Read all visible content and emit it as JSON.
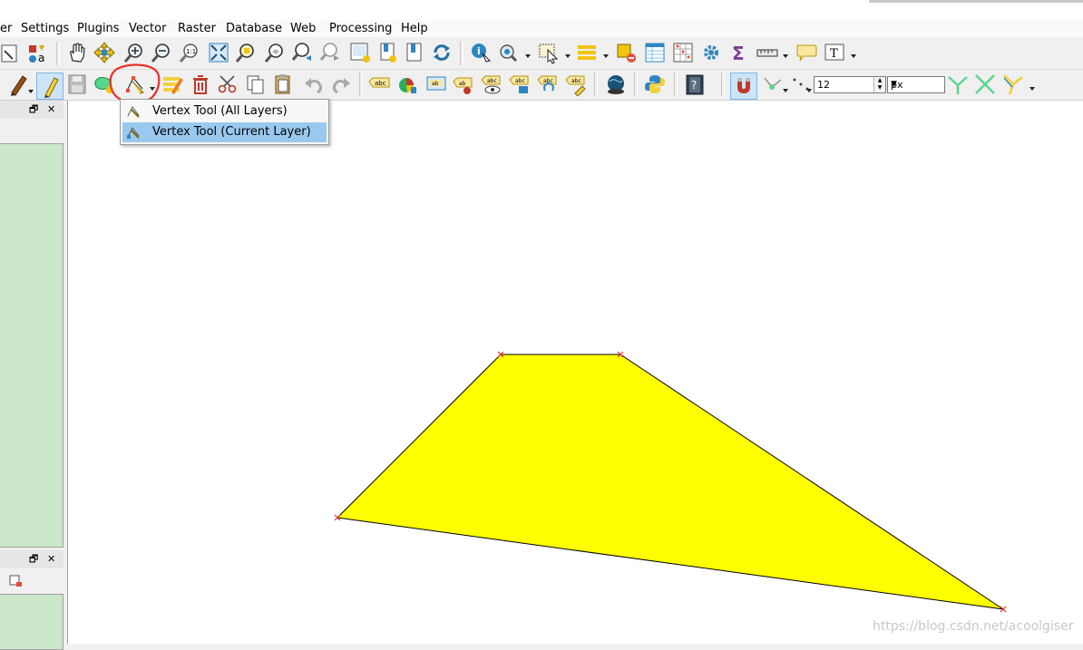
{
  "menubar": {
    "items": [
      {
        "label": "er"
      },
      {
        "label": "Settings"
      },
      {
        "label": "Plugins"
      },
      {
        "label": "Vector"
      },
      {
        "label": "Raster"
      },
      {
        "label": "Database"
      },
      {
        "label": "Web"
      },
      {
        "label": "Processing"
      },
      {
        "label": "Help"
      }
    ]
  },
  "toolbar_snapping": {
    "tolerance_value": "12",
    "tolerance_unit": "px"
  },
  "vertex_tool_menu": {
    "items": [
      {
        "label": "Vertex Tool (All Layers)",
        "selected": false
      },
      {
        "label": "Vertex Tool (Current Layer)",
        "selected": true
      }
    ]
  },
  "left_dock": {
    "restore_glyph": "🗗",
    "close_glyph": "✕"
  },
  "map_canvas": {
    "polygon": {
      "fill_color": "#ffff00",
      "stroke_color": "#000000",
      "vertex_marker_color": "#e8302a"
    }
  },
  "colors": {
    "highlight_annotation": "#e8302a",
    "selection": "#99c9ef"
  },
  "watermark": {
    "text": "https://blog.csdn.net/acoolgiser"
  }
}
